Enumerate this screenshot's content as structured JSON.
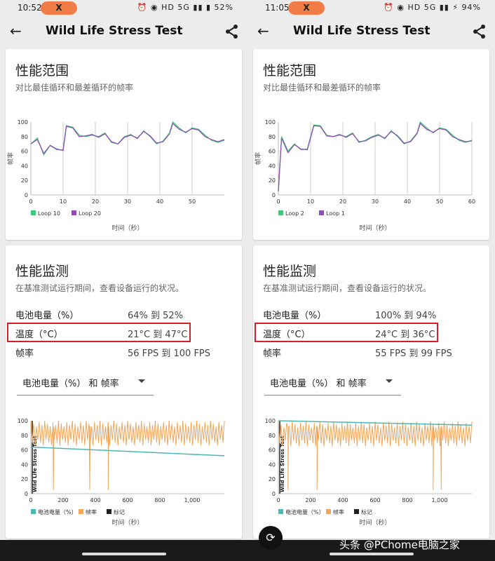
{
  "panels": [
    {
      "status": {
        "time": "10:52",
        "pill": "X",
        "icons": "⏰ ◉ HD 5G ▮▮ ▮ 52%"
      },
      "appbar": {
        "title": "Wild Life Stress Test"
      },
      "perf_range": {
        "title": "性能范围",
        "subtitle": "对比最佳循环和最差循环的帧率",
        "ylabel": "帧率",
        "xlabel": "时间（秒）",
        "legend": [
          "Loop 10",
          "Loop 20"
        ]
      },
      "perf_monitor": {
        "title": "性能监测",
        "subtitle": "在基准测试运行期间，查看设备运行的状况。",
        "rows": [
          {
            "k": "电池电量（%）",
            "v": "64% 到 52%"
          },
          {
            "k": "温度（°C）",
            "v": "21°C 到 47°C"
          },
          {
            "k": "帧率",
            "v": "56 FPS 到 100 FPS"
          }
        ],
        "dropdown": "电池电量（%） 和 帧率",
        "xlabel": "时间（秒）",
        "vert_label": "Wild Life Stress Test",
        "legend": [
          "电池电量（%）",
          "帧率",
          "标记"
        ]
      }
    },
    {
      "status": {
        "time": "11:05",
        "pill": "X",
        "icons": "⏰ ◉ HD 5G ▮▮ ⚡ 94%"
      },
      "appbar": {
        "title": "Wild Life Stress Test"
      },
      "perf_range": {
        "title": "性能范围",
        "subtitle": "对比最佳循环和最差循环的帧率",
        "ylabel": "帧率",
        "xlabel": "时间（秒）",
        "legend": [
          "Loop 2",
          "Loop 1"
        ]
      },
      "perf_monitor": {
        "title": "性能监测",
        "subtitle": "在基准测试运行期间，查看设备运行的状况。",
        "rows": [
          {
            "k": "电池电量（%）",
            "v": "100% 到 94%"
          },
          {
            "k": "温度（°C）",
            "v": "24°C 到 36°C"
          },
          {
            "k": "帧率",
            "v": "55 FPS 到 99 FPS"
          }
        ],
        "dropdown": "电池电量（%） 和 帧率",
        "xlabel": "时间（秒）",
        "vert_label": "Wild Life Stress Test",
        "legend": [
          "电池电量（%）",
          "帧率",
          "标记"
        ]
      }
    }
  ],
  "watermark": "头条 @PChome电脑之家",
  "colors": {
    "loopA": "#3ec97a",
    "loopB": "#8e4fb4",
    "battery": "#4bb8b4",
    "fps": "#f2a65a",
    "marker": "#222222",
    "highlight": "#d81e26"
  },
  "chart_data": [
    {
      "type": "line",
      "title": "",
      "xlabel": "时间（秒）",
      "ylabel": "帧率",
      "xlim": [
        0,
        60
      ],
      "ylim": [
        0,
        100
      ],
      "xticks": [
        "0",
        "10",
        "20",
        "30",
        "40",
        "50"
      ],
      "yticks": [
        "0",
        "20",
        "40",
        "60",
        "80",
        "100"
      ],
      "x": [
        0,
        2,
        4,
        6,
        8,
        10,
        11,
        13,
        15,
        17,
        19,
        21,
        23,
        25,
        27,
        29,
        31,
        33,
        35,
        37,
        39,
        41,
        43,
        44,
        46,
        48,
        50,
        52,
        54,
        56,
        58,
        60
      ],
      "series": [
        {
          "name": "Loop 10",
          "values": [
            70,
            78,
            55,
            68,
            62,
            62,
            95,
            93,
            82,
            80,
            82,
            80,
            85,
            72,
            70,
            80,
            83,
            77,
            88,
            80,
            70,
            74,
            85,
            100,
            92,
            85,
            92,
            90,
            82,
            75,
            72,
            75
          ]
        },
        {
          "name": "Loop 20",
          "values": [
            70,
            76,
            57,
            68,
            63,
            61,
            94,
            92,
            80,
            81,
            83,
            79,
            84,
            73,
            70,
            79,
            82,
            78,
            87,
            81,
            71,
            73,
            84,
            98,
            90,
            86,
            91,
            89,
            80,
            76,
            73,
            76
          ]
        }
      ]
    },
    {
      "type": "line",
      "title": "",
      "xlabel": "时间（秒）",
      "ylabel": "",
      "xlim": [
        0,
        1200
      ],
      "ylim": [
        0,
        100
      ],
      "xticks": [
        "0",
        "200",
        "400",
        "600",
        "800",
        "1,000"
      ],
      "yticks": [
        "0",
        "20",
        "40",
        "60",
        "80",
        "100"
      ],
      "series": [
        {
          "name": "电池电量（%）",
          "x": [
            0,
            200,
            400,
            600,
            800,
            1000,
            1200
          ],
          "values": [
            64,
            62,
            60,
            58,
            56,
            54,
            52
          ]
        },
        {
          "name": "帧率",
          "x_range": [
            0,
            1200
          ],
          "min": 56,
          "max": 100,
          "dips_at": [
            140,
            365,
            480
          ],
          "dip_value": 5
        }
      ]
    },
    {
      "type": "line",
      "title": "",
      "xlabel": "时间（秒）",
      "ylabel": "帧率",
      "xlim": [
        0,
        60
      ],
      "ylim": [
        0,
        100
      ],
      "xticks": [
        "0",
        "10",
        "20",
        "30",
        "40",
        "50",
        "60"
      ],
      "yticks": [
        "0",
        "20",
        "40",
        "60",
        "80",
        "100"
      ],
      "x": [
        0,
        1,
        3,
        5,
        7,
        9,
        11,
        13,
        15,
        17,
        19,
        21,
        23,
        25,
        27,
        29,
        31,
        33,
        35,
        37,
        39,
        41,
        43,
        44,
        46,
        48,
        50,
        52,
        54,
        56,
        58,
        60
      ],
      "series": [
        {
          "name": "Loop 2",
          "values": [
            5,
            80,
            60,
            70,
            62,
            63,
            96,
            95,
            82,
            80,
            82,
            80,
            85,
            72,
            75,
            80,
            83,
            77,
            88,
            80,
            70,
            74,
            85,
            100,
            92,
            85,
            92,
            90,
            82,
            75,
            72,
            75
          ]
        },
        {
          "name": "Loop 1",
          "values": [
            5,
            78,
            58,
            69,
            63,
            62,
            95,
            94,
            81,
            80,
            83,
            79,
            84,
            73,
            74,
            79,
            82,
            78,
            87,
            81,
            71,
            73,
            84,
            98,
            90,
            86,
            91,
            89,
            80,
            76,
            73,
            74
          ]
        }
      ]
    },
    {
      "type": "line",
      "title": "",
      "xlabel": "时间（秒）",
      "ylabel": "",
      "xlim": [
        0,
        1200
      ],
      "ylim": [
        0,
        100
      ],
      "xticks": [
        "0",
        "200",
        "400",
        "600",
        "800",
        "1,000"
      ],
      "yticks": [
        "0",
        "20",
        "40",
        "60",
        "80",
        "100"
      ],
      "series": [
        {
          "name": "电池电量（%）",
          "x": [
            0,
            200,
            400,
            600,
            800,
            1000,
            1200
          ],
          "values": [
            100,
            99,
            98,
            97,
            96,
            95,
            94
          ]
        },
        {
          "name": "帧率",
          "x_range": [
            0,
            1200
          ],
          "min": 55,
          "max": 99,
          "dips_at": [
            60,
            240,
            960,
            1010
          ],
          "dip_value": 5
        }
      ]
    }
  ]
}
